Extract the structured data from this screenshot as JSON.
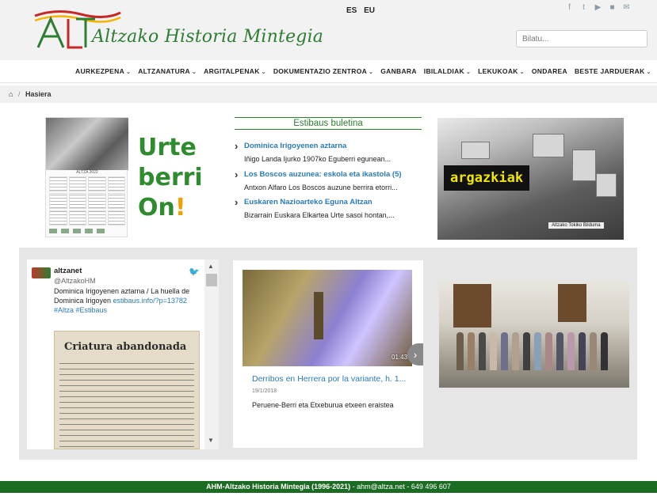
{
  "header": {
    "logo_text": "Altzako Historia Mintegia",
    "languages": [
      "ES",
      "EU"
    ],
    "social_icons": [
      "facebook-icon",
      "twitter-icon",
      "youtube-icon",
      "flickr-icon",
      "email-icon"
    ],
    "search_placeholder": "Bilatu..."
  },
  "nav": {
    "items": [
      {
        "label": "AURKEZPENA",
        "dropdown": true
      },
      {
        "label": "ALTZANATURA",
        "dropdown": true
      },
      {
        "label": "ARGITALPENAK",
        "dropdown": true
      },
      {
        "label": "DOKUMENTAZIO ZENTROA",
        "dropdown": true
      },
      {
        "label": "GANBARA",
        "dropdown": false
      },
      {
        "label": "IBILALDIAK",
        "dropdown": true
      },
      {
        "label": "LEKUKOAK",
        "dropdown": true
      },
      {
        "label": "ONDAREA",
        "dropdown": false
      },
      {
        "label": "BESTE JARDUERAK",
        "dropdown": true
      }
    ]
  },
  "breadcrumb": {
    "current": "Hasiera"
  },
  "calendar": {
    "year_label": "ALTZA 2022",
    "greeting_lines": [
      "Urte",
      "berri",
      "On",
      "!"
    ]
  },
  "bulletin": {
    "title": "Estibaus buletina",
    "items": [
      {
        "title": "Dominica Irigoyenen aztarna",
        "excerpt": "Iñigo Landa Ijurko 1907ko Eguberri egunean..."
      },
      {
        "title": "Los Boscos auzunea: eskola eta ikastola (5)",
        "excerpt": "Antxon Alfaro Los Boscos auzune berrira etorri..."
      },
      {
        "title": "Euskaren Nazioarteko Eguna Altzan",
        "excerpt": "Bizarrain Euskara Elkartea Urte sasoi hontan,..."
      }
    ]
  },
  "argazkiak": {
    "label": "argazkiak",
    "caption": "Altzako Tokiko Bilduma"
  },
  "twitter": {
    "name": "altzanet",
    "handle": "@AltzakoHM",
    "text": "Dominica Irigoyenen aztarna / La huella de Dominica Irigoyen",
    "link": "estibaus.info/?p=13782",
    "hashtags": "#Altza #Estibaus",
    "image_heading": "Criatura abandonada"
  },
  "video": {
    "duration": "01:43",
    "title": "Derribos en Herrera por la variante, h. 1...",
    "date": "19/1/2018",
    "description": "Peruene-Berri eta Etxeburua etxeen eraistea"
  },
  "footer": {
    "org": "AHM-Altzako Historia Mintegia (1996-2021)",
    "contact": " - ahm@altza.net - 649 496 607"
  },
  "colors": {
    "brand_green": "#2e7d32",
    "link_blue": "#2a7ab8",
    "footer_green": "#1b6b22"
  }
}
